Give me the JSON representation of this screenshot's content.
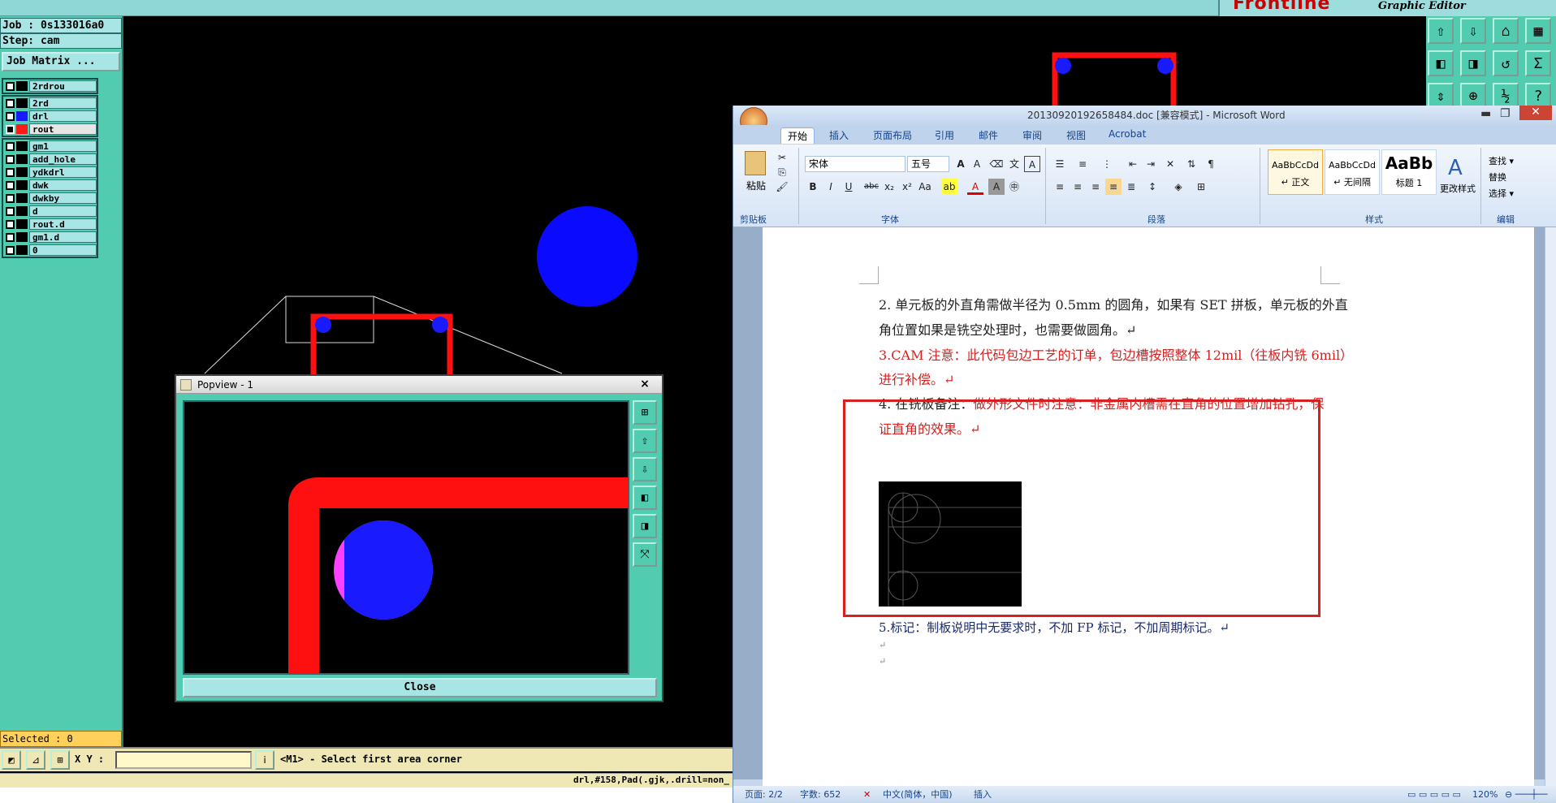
{
  "top": {
    "brand_logo": "Frontline",
    "brand_sub": "Graphic Editor"
  },
  "left": {
    "job": "Job : 0s133016a0",
    "step": "Step: cam",
    "job_matrix": "Job Matrix ...",
    "top_layer": "2rdrou",
    "layers_group1": [
      {
        "name": "2rd",
        "color": "#000000"
      },
      {
        "name": "drl",
        "color": "#1a1aff"
      },
      {
        "name": "rout",
        "color": "#ff1a1a",
        "selected": true
      }
    ],
    "layers_group2": [
      "gm1",
      "add_hole",
      "ydkdrl",
      "dwk",
      "dwkby",
      "d",
      "rout.d",
      "gm1.d",
      "0"
    ],
    "selected": "Selected : 0"
  },
  "bottom": {
    "xy_label": "X Y :",
    "xy_value": "",
    "prompt": "<M1> - Select first area corner",
    "status": "drl,#158,Pad(.gjk,.drill=non_"
  },
  "popview": {
    "title": "Popview - 1",
    "close": "Close",
    "close_icon": "×"
  },
  "word": {
    "title": "20130920192658484.doc [兼容模式] - Microsoft Word",
    "tabs": [
      "开始",
      "插入",
      "页面布局",
      "引用",
      "邮件",
      "审阅",
      "视图",
      "Acrobat"
    ],
    "font_name": "宋体",
    "font_size": "五号",
    "paste": "粘贴",
    "groups": [
      "剪贴板",
      "字体",
      "段落",
      "样式",
      "编辑"
    ],
    "styles": [
      {
        "preview": "AaBbCcDd",
        "name": "↵ 正文"
      },
      {
        "preview": "AaBbCcDd",
        "name": "↵ 无间隔"
      },
      {
        "preview": "AaBb",
        "name": "标题 1"
      }
    ],
    "change_styles": "更改样式",
    "edit_items": [
      "查找 ▾",
      "替换",
      "选择 ▾"
    ],
    "paragraphs": {
      "p2a": "2.  单元板的外直角需做半径为 0.5mm 的圆角，如果有 SET 拼板，单元板的外直",
      "p2b": "角位置如果是铣空处理时，也需要做圆角。↵",
      "p3a": "3.CAM 注意：此代码包边工艺的订单，包边槽按照整体 12mil（往板内铣 6mil）",
      "p3b": "进行补偿。↵",
      "p4a_black": "4.  在铣板备注：",
      "p4a_red": "做外形文件时注意：非金属内槽需在直角的位置增加钻孔，保",
      "p4b": "证直角的效果。↵",
      "p5": "5.标记：制板说明中无要求时，不加 FP 标记，不加周期标记。↵",
      "p6": "↵",
      "p7": "↵"
    },
    "status": {
      "page": "页面: 2/2",
      "words": "字数: 652",
      "lang": "中文(简体，中国)",
      "mode": "插入",
      "zoom": "120%"
    }
  }
}
